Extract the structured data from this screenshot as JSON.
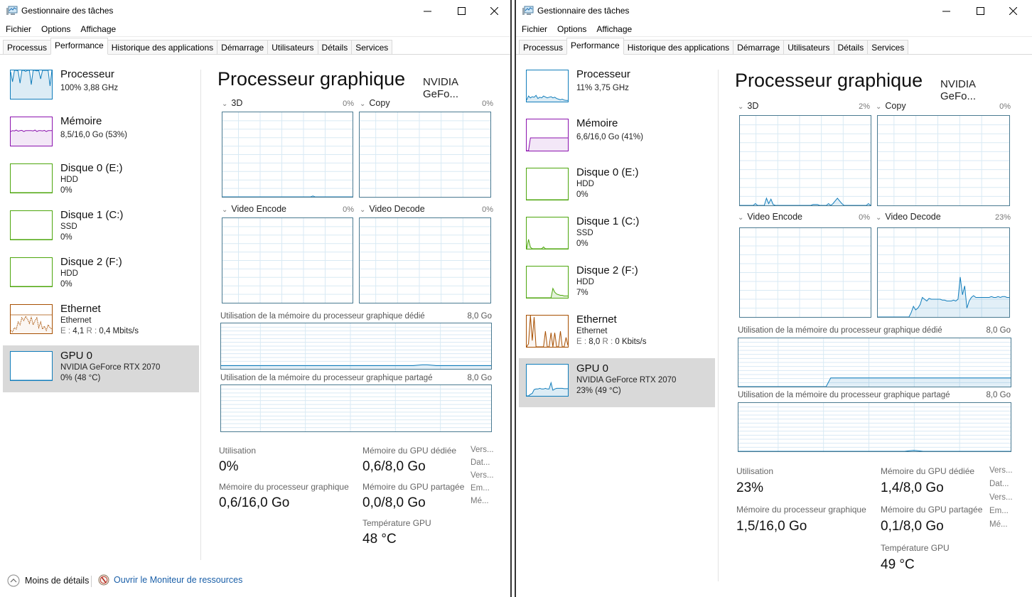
{
  "common": {
    "title": "Gestionnaire des tâches",
    "menu": [
      "Fichier",
      "Options",
      "Affichage"
    ],
    "tabs": [
      "Processus",
      "Performance",
      "Historique des applications",
      "Démarrage",
      "Utilisateurs",
      "Détails",
      "Services"
    ],
    "active_tab": "Performance",
    "icons": {
      "app": "task-manager-icon",
      "minimize": "minimize-icon",
      "maximize": "maximize-icon",
      "close": "close-icon",
      "chevron": "chevron-down-icon",
      "less_details": "chevron-up-circle-icon",
      "resource_monitor": "resource-monitor-icon"
    },
    "gpu_title": "Processeur graphique",
    "gpu_name": "NVIDIA GeFo...",
    "engines": [
      "3D",
      "Copy",
      "Video Encode",
      "Video Decode"
    ],
    "mem_dedicated_label": "Utilisation de la mémoire du processeur graphique dédié",
    "mem_shared_label": "Utilisation de la mémoire du processeur graphique partagé",
    "mem_max": "8,0 Go",
    "stat_labels": {
      "utilisation": "Utilisation",
      "gpu_memory": "Mémoire du processeur graphique",
      "dedicated": "Mémoire du GPU dédiée",
      "shared": "Mémoire du GPU partagée",
      "temperature": "Température GPU"
    },
    "props": [
      "Vers...",
      "Dat...",
      "Vers...",
      "Em...",
      "Mé..."
    ],
    "footer": {
      "less_details": "Moins de détails",
      "resource_monitor": "Ouvrir le Moniteur de ressources"
    },
    "colors": {
      "cpu": "#117dbb",
      "memory": "#8b12ae",
      "disk": "#4da60c",
      "ethernet": "#a74f01",
      "gpu": "#117dbb",
      "graph_border": "#4a7a91",
      "grid": "#d9eaf4",
      "selected_bg": "#d9d9d9",
      "link": "#1a5fa8"
    }
  },
  "left": {
    "sidebar": [
      {
        "title": "Processeur",
        "line1": "100% 3,88 GHz",
        "line2": "",
        "kind": "cpu",
        "selected": false
      },
      {
        "title": "Mémoire",
        "line1": "8,5/16,0 Go (53%)",
        "line2": "",
        "kind": "memory",
        "selected": false
      },
      {
        "title": "Disque 0 (E:)",
        "line1": "HDD",
        "line2": "0%",
        "kind": "disk",
        "selected": false
      },
      {
        "title": "Disque 1 (C:)",
        "line1": "SSD",
        "line2": "0%",
        "kind": "disk",
        "selected": false
      },
      {
        "title": "Disque 2 (F:)",
        "line1": "HDD",
        "line2": "0%",
        "kind": "disk",
        "selected": false
      },
      {
        "title": "Ethernet",
        "line1": "Ethernet",
        "line2_send_label": "E :",
        "line2_send": "4,1",
        "line2_recv_label": "R :",
        "line2_recv": "0,4 Mbits/s",
        "kind": "ethernet",
        "selected": false
      },
      {
        "title": "GPU 0",
        "line1": "NVIDIA GeForce RTX 2070",
        "line2": "0%  (48 °C)",
        "kind": "gpu",
        "selected": true
      }
    ],
    "engine_pcts": [
      "0%",
      "0%",
      "0%",
      "0%"
    ],
    "stats": {
      "utilisation": "0%",
      "gpu_memory": "0,6/16,0 Go",
      "dedicated": "0,6/8,0 Go",
      "shared": "0,0/8,0 Go",
      "temperature": "48 °C"
    },
    "series": {
      "cpu": [
        95,
        60,
        100,
        100,
        98,
        55,
        100,
        100,
        96,
        100,
        100,
        50,
        100,
        100,
        98,
        100,
        70,
        100,
        100,
        100,
        100,
        45,
        100
      ],
      "memory": [
        50,
        53,
        52,
        55,
        51,
        53,
        54,
        50,
        53,
        53,
        53,
        53,
        52,
        55,
        50,
        53,
        53,
        52,
        54,
        50,
        53,
        53,
        53
      ],
      "disk": [
        0,
        0,
        0,
        0,
        0,
        0,
        0,
        0,
        0,
        0,
        0,
        0,
        0,
        0,
        0,
        0,
        0,
        0,
        0,
        0,
        0,
        0,
        0
      ],
      "ethernet": [
        10,
        5,
        20,
        15,
        40,
        30,
        55,
        45,
        60,
        50,
        35,
        58,
        30,
        45,
        55,
        20,
        40,
        15,
        25,
        10,
        30,
        20,
        15
      ],
      "gpu": [
        0,
        0,
        0,
        0,
        0,
        0,
        0,
        0,
        0,
        0,
        0,
        0,
        0,
        0,
        0,
        0,
        0,
        0,
        0,
        0,
        0,
        0,
        0
      ],
      "3d": [
        0,
        0,
        0,
        0,
        0,
        0,
        0,
        0,
        0,
        0,
        0,
        0,
        0,
        0,
        0,
        0,
        0,
        0,
        0,
        0,
        0,
        0,
        0,
        0,
        0,
        0,
        0,
        0,
        0,
        0,
        0,
        0,
        0,
        0,
        0,
        0,
        0,
        0,
        0,
        0,
        0,
        1,
        0,
        0,
        0,
        0,
        0,
        0,
        0,
        0,
        0,
        0,
        0,
        0,
        0,
        0,
        0,
        0,
        0,
        0
      ],
      "copy": [
        0
      ],
      "encode": [
        0
      ],
      "decode": [
        0
      ],
      "mem_dedicated": [
        7,
        7,
        7,
        7,
        7,
        7,
        7,
        7,
        7,
        7,
        7,
        7,
        7,
        7,
        7,
        7,
        7,
        7,
        7,
        7,
        7,
        7,
        7,
        7,
        7,
        7,
        7,
        7,
        7,
        7,
        7,
        7,
        7,
        7,
        7,
        7,
        7,
        7,
        7,
        7,
        7,
        7,
        7,
        8,
        9,
        9,
        8,
        7,
        7,
        7,
        7,
        7,
        7,
        7,
        7,
        7,
        7,
        7,
        7,
        7
      ],
      "mem_shared": [
        0
      ]
    }
  },
  "right": {
    "sidebar": [
      {
        "title": "Processeur",
        "line1": "11% 3,75 GHz",
        "line2": "",
        "kind": "cpu",
        "selected": false
      },
      {
        "title": "Mémoire",
        "line1": "6,6/16,0 Go (41%)",
        "line2": "",
        "kind": "memory",
        "selected": false
      },
      {
        "title": "Disque 0 (E:)",
        "line1": "HDD",
        "line2": "0%",
        "kind": "disk",
        "selected": false
      },
      {
        "title": "Disque 1 (C:)",
        "line1": "SSD",
        "line2": "0%",
        "kind": "disk",
        "selected": false
      },
      {
        "title": "Disque 2 (F:)",
        "line1": "HDD",
        "line2": "7%",
        "kind": "disk",
        "selected": false
      },
      {
        "title": "Ethernet",
        "line1": "Ethernet",
        "line2_send_label": "E :",
        "line2_send": "8,0",
        "line2_recv_label": "R :",
        "line2_recv": "0 Kbits/s",
        "kind": "ethernet",
        "selected": false
      },
      {
        "title": "GPU 0",
        "line1": "NVIDIA GeForce RTX 2070",
        "line2": "23%  (49 °C)",
        "kind": "gpu",
        "selected": true
      }
    ],
    "engine_pcts": [
      "2%",
      "0%",
      "0%",
      "23%"
    ],
    "stats": {
      "utilisation": "23%",
      "gpu_memory": "1,5/16,0 Go",
      "dedicated": "1,4/8,0 Go",
      "shared": "0,1/8,0 Go",
      "temperature": "49 °C"
    },
    "series": {
      "cpu": [
        5,
        18,
        12,
        16,
        14,
        20,
        10,
        14,
        12,
        18,
        15,
        12,
        14,
        16,
        12,
        14,
        10,
        8,
        6,
        8,
        5,
        4,
        4
      ],
      "memory": [
        0,
        0,
        41,
        41,
        41,
        41,
        41,
        41,
        41,
        41,
        41,
        41,
        41,
        41,
        41,
        41,
        41,
        41,
        41,
        41,
        41,
        41,
        41
      ],
      "disk0": [
        0,
        0,
        0,
        0,
        0,
        0,
        0,
        0,
        0,
        0,
        0,
        0,
        0,
        0,
        0,
        0,
        0,
        0,
        0,
        0,
        0,
        0,
        0
      ],
      "disk1": [
        0,
        30,
        5,
        0,
        0,
        0,
        0,
        0,
        0,
        6,
        0,
        0,
        0,
        0,
        0,
        0,
        0,
        0,
        0,
        0,
        0,
        0,
        0
      ],
      "disk2": [
        0,
        0,
        0,
        0,
        0,
        0,
        0,
        0,
        0,
        0,
        0,
        0,
        0,
        0,
        30,
        18,
        12,
        10,
        8,
        8,
        6,
        6,
        6
      ],
      "ethernet": [
        0,
        10,
        100,
        20,
        95,
        0,
        0,
        0,
        0,
        0,
        50,
        0,
        0,
        45,
        0,
        45,
        0,
        0,
        50,
        0,
        0,
        30,
        5
      ],
      "gpu": [
        0,
        0,
        5,
        8,
        20,
        22,
        22,
        24,
        22,
        22,
        24,
        22,
        22,
        42,
        18,
        22,
        24,
        24,
        24,
        24,
        23,
        23,
        23
      ],
      "3d": [
        0,
        0,
        0,
        0,
        0,
        0,
        0,
        2,
        0,
        0,
        0,
        0,
        8,
        2,
        7,
        1,
        0,
        0,
        0,
        0,
        0,
        0,
        0,
        0,
        0,
        0,
        0,
        0,
        0,
        0,
        0,
        0,
        0,
        1,
        1,
        1,
        0,
        0,
        0,
        0,
        2,
        0,
        2,
        5,
        8,
        5,
        2,
        0,
        0,
        0,
        0,
        0,
        0,
        0,
        0,
        0,
        0,
        0,
        2,
        0
      ],
      "copy": [
        0
      ],
      "encode": [
        0
      ],
      "decode": [
        0,
        0,
        0,
        0,
        0,
        0,
        0,
        0,
        0,
        0,
        0,
        0,
        0,
        0,
        0,
        5,
        12,
        8,
        10,
        14,
        22,
        20,
        18,
        21,
        20,
        20,
        20,
        20,
        20,
        19,
        19,
        18,
        18,
        18,
        19,
        18,
        20,
        45,
        25,
        35,
        10,
        18,
        22,
        24,
        22,
        22,
        22,
        22,
        22,
        22,
        22,
        23,
        22,
        22,
        23,
        22,
        23,
        23,
        22,
        22
      ],
      "mem_dedicated": [
        0,
        0,
        0,
        0,
        0,
        0,
        0,
        0,
        0,
        0,
        0,
        0,
        0,
        0,
        0,
        0,
        0,
        0,
        0,
        0,
        18,
        18,
        18,
        18,
        18,
        18,
        18,
        18,
        18,
        18,
        18,
        18,
        18,
        18,
        18,
        18,
        18,
        18,
        18,
        18,
        18,
        18,
        18,
        18,
        18,
        18,
        18,
        18,
        18,
        18,
        18,
        18,
        18,
        18,
        18,
        18,
        18,
        18,
        18,
        18
      ],
      "mem_shared": [
        0,
        0,
        0,
        0,
        0,
        0,
        0,
        0,
        0,
        0,
        0,
        0,
        0,
        0,
        0,
        0,
        0,
        0,
        0,
        0,
        0,
        0,
        0,
        0,
        0,
        0,
        0,
        0,
        0,
        0,
        0,
        0,
        0,
        0,
        0,
        0,
        0,
        1,
        2,
        1,
        0,
        0,
        0,
        0,
        0,
        0,
        0,
        0,
        0,
        0,
        0,
        0,
        0,
        0,
        0,
        0,
        0,
        0,
        0,
        0
      ]
    }
  }
}
